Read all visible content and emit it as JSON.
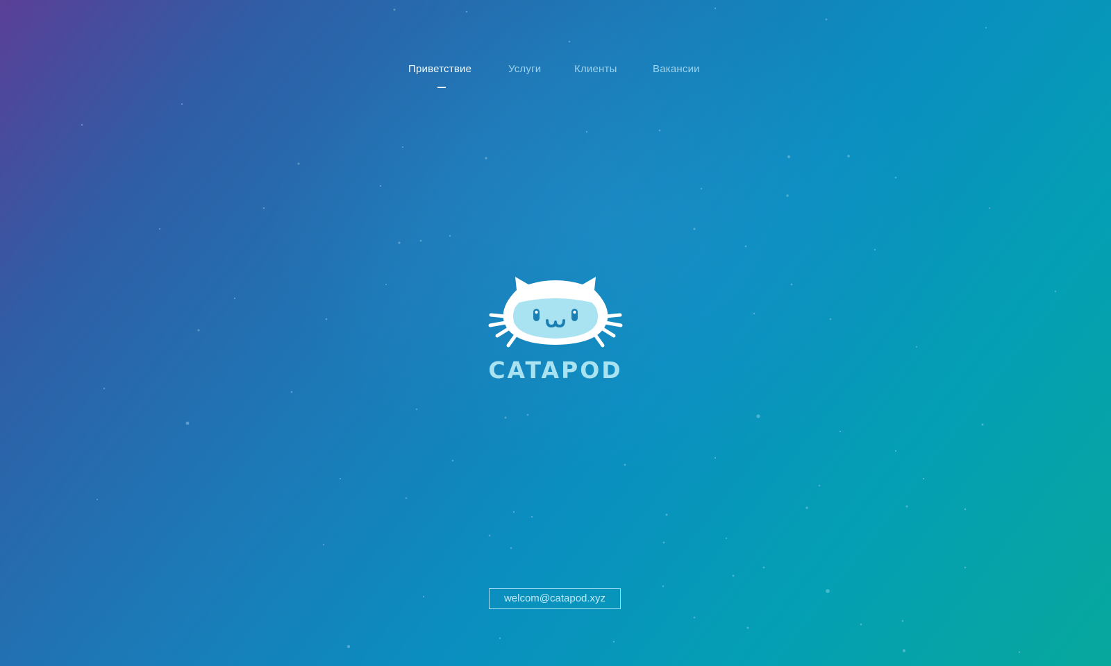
{
  "nav": {
    "items": [
      {
        "label": "Приветствие",
        "active": true
      },
      {
        "label": "Услуги",
        "active": false
      },
      {
        "label": "Клиенты",
        "active": false
      },
      {
        "label": "Вакансии",
        "active": false
      }
    ]
  },
  "logo": {
    "icon": "cat-astronaut-icon",
    "wordmark": "CATAPOD"
  },
  "contact": {
    "email": "welcom@catapod.xyz"
  },
  "colors": {
    "gradient_start": "#5a3f97",
    "gradient_mid": "#0a8ec0",
    "gradient_end": "#07a79c",
    "logo_white": "#ffffff",
    "logo_visor": "#a9e3f1",
    "logo_face_features": "#1c7fb3"
  }
}
